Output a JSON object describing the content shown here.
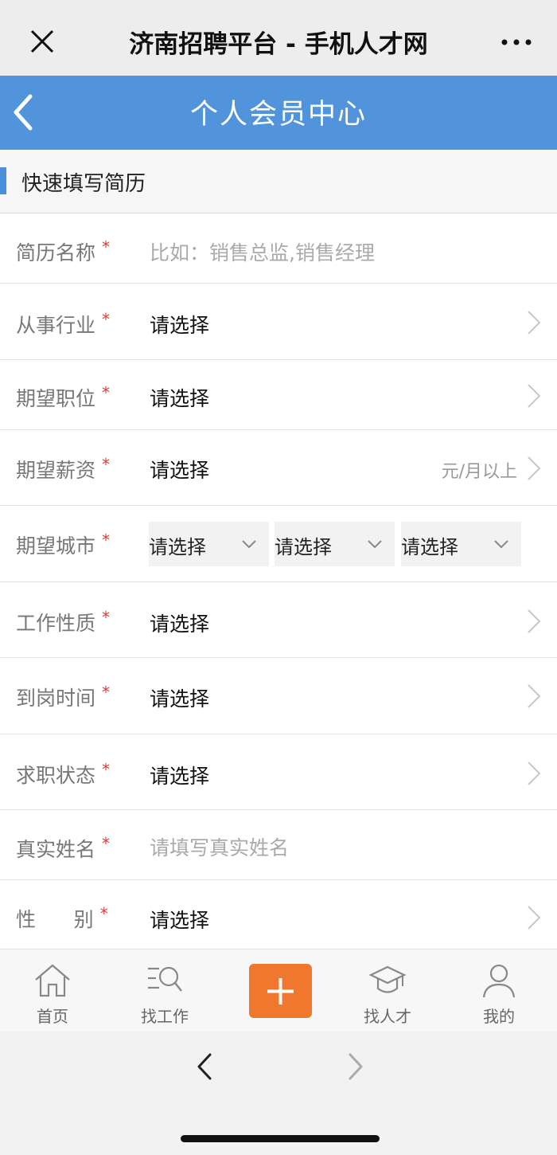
{
  "wechat_bar": {
    "title": "济南招聘平台 - 手机人才网",
    "close_icon": "close-icon",
    "more_icon": "more-dots-icon"
  },
  "header": {
    "title": "个人会员中心",
    "back_icon": "chevron-left-icon",
    "background": "#5294db"
  },
  "section": {
    "title": "快速填写简历",
    "accent": "#4a8fdc"
  },
  "form": {
    "required_mark": "*",
    "resume_name": {
      "label": "简历名称",
      "placeholder": "比如：销售总监,销售经理"
    },
    "industry": {
      "label": "从事行业",
      "value": "请选择"
    },
    "position": {
      "label": "期望职位",
      "value": "请选择"
    },
    "salary": {
      "label": "期望薪资",
      "value": "请选择",
      "suffix": "元/月以上"
    },
    "city": {
      "label": "期望城市",
      "selects": [
        "请选择",
        "请选择",
        "请选择"
      ]
    },
    "job_type": {
      "label": "工作性质",
      "value": "请选择"
    },
    "arrival_time": {
      "label": "到岗时间",
      "value": "请选择"
    },
    "job_status": {
      "label": "求职状态",
      "value": "请选择"
    },
    "real_name": {
      "label": "真实姓名",
      "placeholder": "请填写真实姓名"
    },
    "gender": {
      "label": "性      别",
      "value": "请选择"
    }
  },
  "tabbar": {
    "items": [
      {
        "label": "首页",
        "icon": "home-icon"
      },
      {
        "label": "找工作",
        "icon": "job-search-icon"
      },
      {
        "label": "找人才",
        "icon": "graduation-cap-icon"
      },
      {
        "label": "我的",
        "icon": "user-icon"
      }
    ],
    "add_icon": "plus-icon",
    "add_color": "#f0772e"
  },
  "browser": {
    "back_icon": "chevron-left-icon",
    "forward_icon": "chevron-right-icon"
  }
}
